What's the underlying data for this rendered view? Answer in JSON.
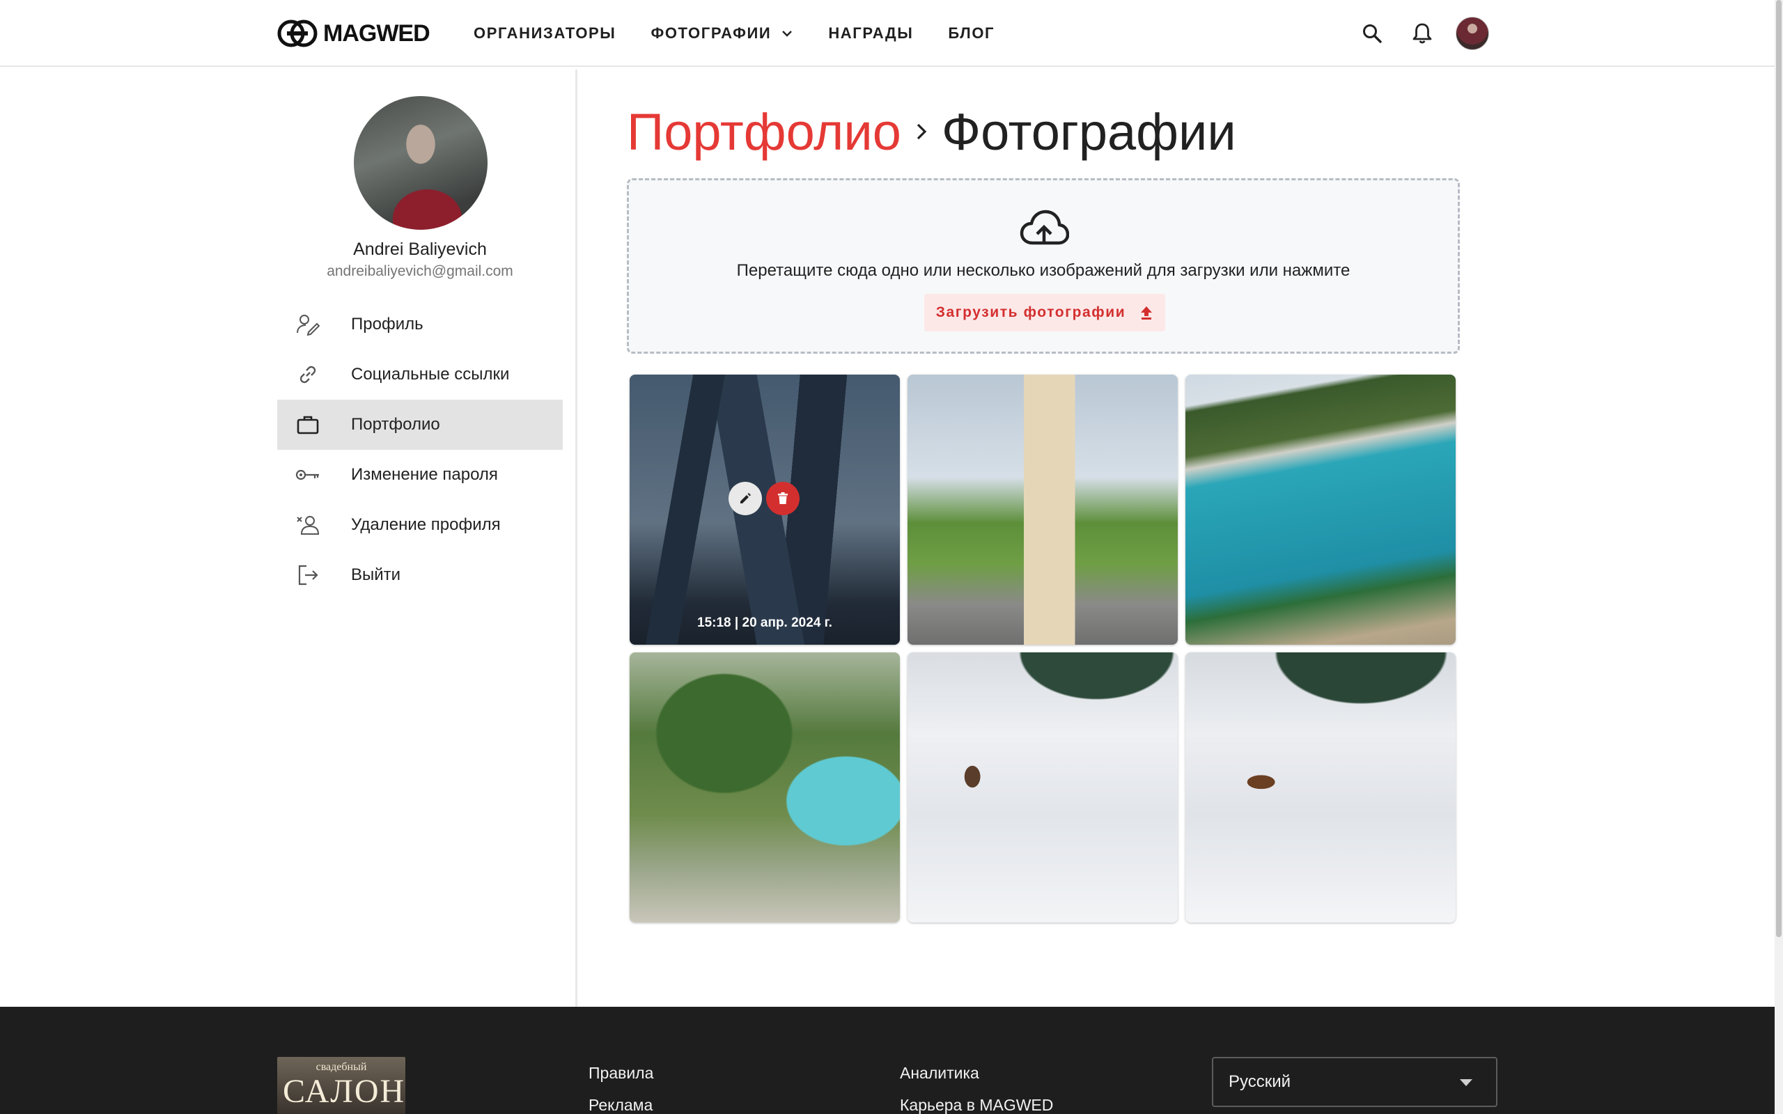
{
  "header": {
    "logo_text": "MAGWED",
    "nav": [
      {
        "label": "ОРГАНИЗАТОРЫ"
      },
      {
        "label": "ФОТОГРАФИИ"
      },
      {
        "label": "НАГРАДЫ"
      },
      {
        "label": "БЛОГ"
      }
    ],
    "icons": [
      "search-icon",
      "bell-icon",
      "user-avatar"
    ]
  },
  "sidebar": {
    "name": "Andrei Baliyevich",
    "email": "andreibaliyevich@gmail.com",
    "items": [
      {
        "label": "Профиль",
        "icon": "user-edit-icon",
        "active": false
      },
      {
        "label": "Социальные ссылки",
        "icon": "link-icon",
        "active": false
      },
      {
        "label": "Портфолио",
        "icon": "briefcase-icon",
        "active": true
      },
      {
        "label": "Изменение пароля",
        "icon": "key-icon",
        "active": false
      },
      {
        "label": "Удаление профиля",
        "icon": "user-remove-icon",
        "active": false
      },
      {
        "label": "Выйти",
        "icon": "logout-icon",
        "active": false
      }
    ]
  },
  "main": {
    "breadcrumb": {
      "parent": "Портфолио",
      "current": "Фотографии"
    },
    "dropzone": {
      "text": "Перетащите сюда одно или несколько изображений для загрузки или нажмите",
      "button_label": "Загрузить фотографии"
    },
    "photos": [
      {
        "subject": "city-towers",
        "timestamp": "15:18 | 20 апр. 2024 г.",
        "hovered": true
      },
      {
        "subject": "apartment-building"
      },
      {
        "subject": "turquoise-lake"
      },
      {
        "subject": "cliff-with-pines"
      },
      {
        "subject": "squirrel-in-snow"
      },
      {
        "subject": "squirrel-in-snow"
      }
    ]
  },
  "footer": {
    "col1": [
      "Правила",
      "Реклама"
    ],
    "col2": [
      "Аналитика",
      "Карьера в MAGWED"
    ],
    "language": "Русский",
    "logo_top": "свадебный",
    "logo_main": "САЛОН"
  },
  "colors": {
    "accent": "#e53935",
    "active_menu_bg": "#e3e3e3",
    "footer_bg": "#1e1e1e"
  }
}
